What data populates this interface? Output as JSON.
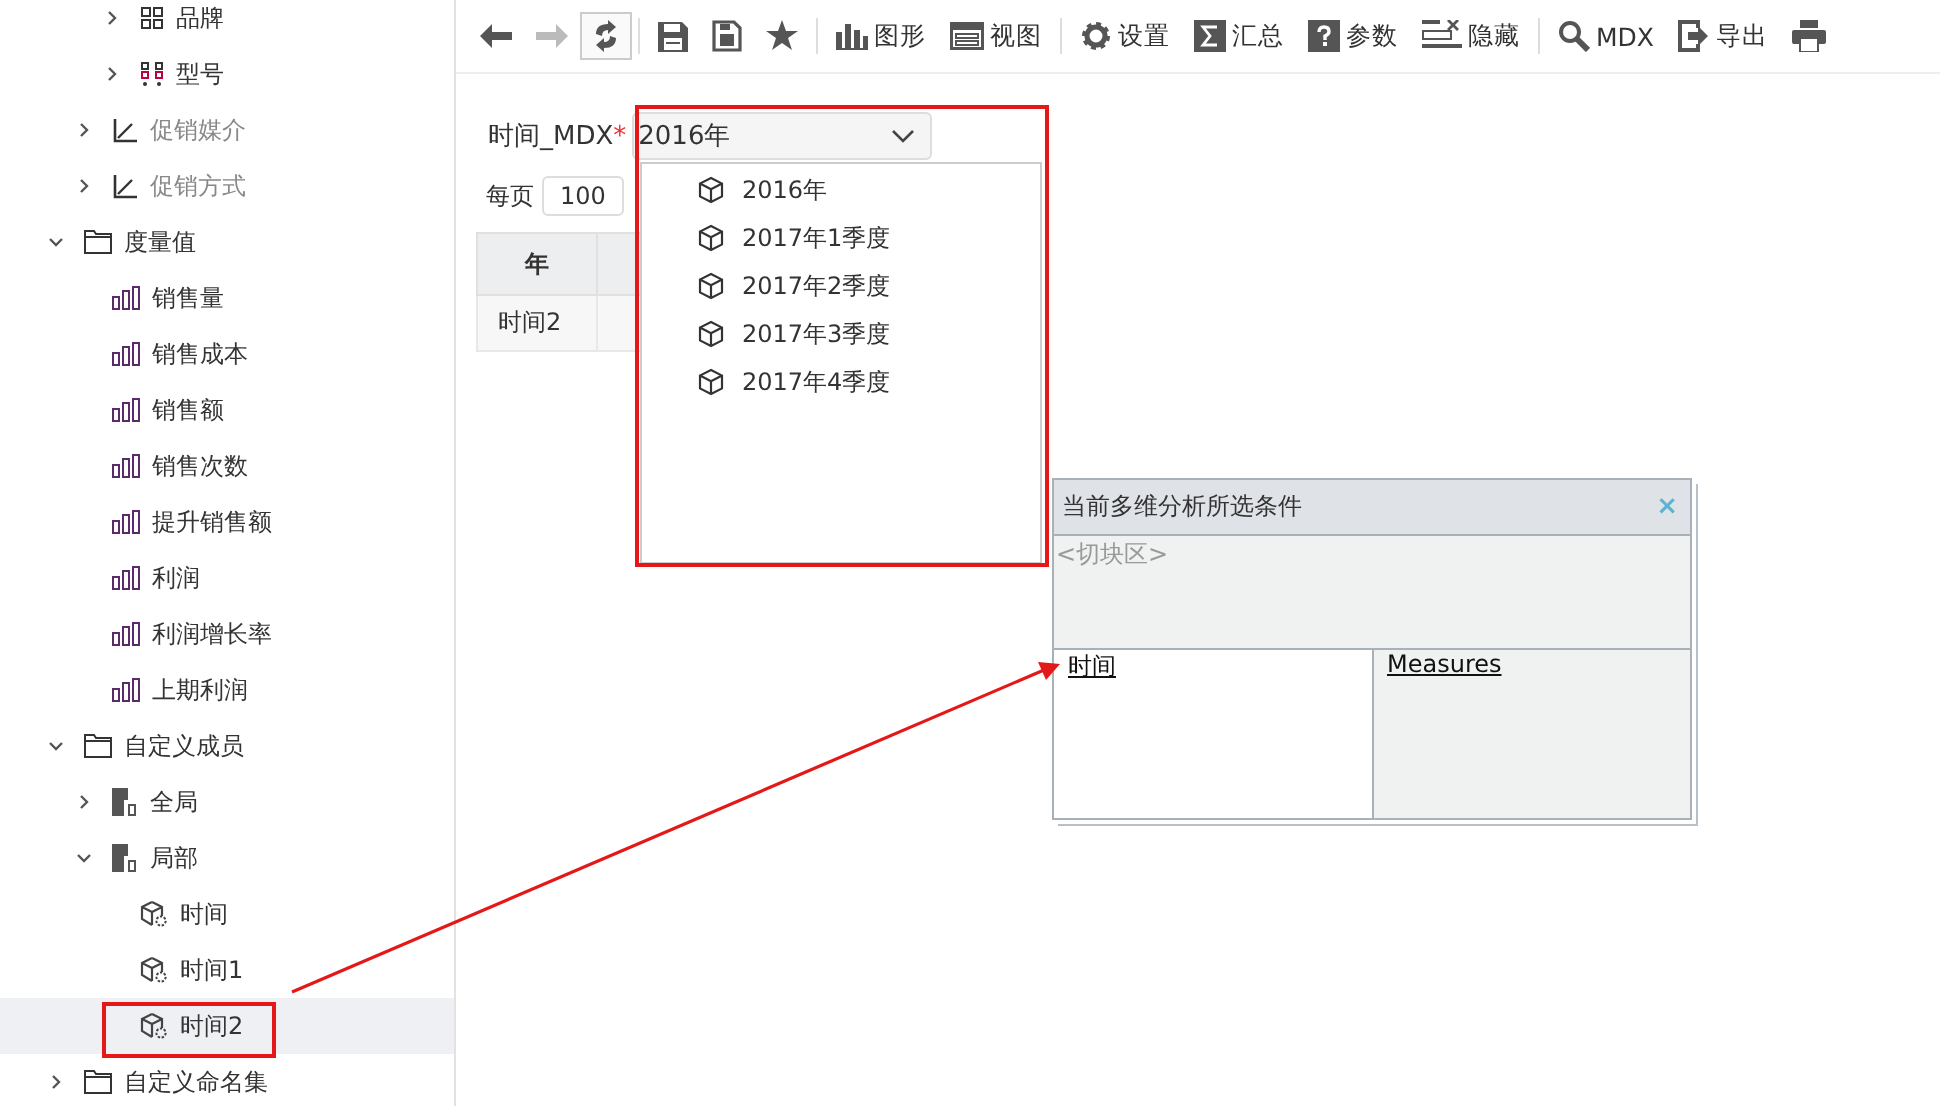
{
  "tree": [
    {
      "children": [
        {
          "children": [
            {
              "label": "品牌",
              "kind": "grid",
              "expanded": false,
              "disabled": false,
              "selected": false
            },
            {
              "label": "型号",
              "kind": "dots",
              "expanded": false,
              "disabled": false,
              "selected": false
            }
          ]
        },
        {
          "label": "促销媒介",
          "kind": "axis",
          "expanded": false,
          "disabled": true,
          "selected": false
        },
        {
          "label": "促销方式",
          "kind": "axis",
          "expanded": false,
          "disabled": true,
          "selected": false
        }
      ]
    },
    {
      "label": "度量值",
      "kind": "folder",
      "expanded": true,
      "disabled": false,
      "selected": false,
      "children": [
        {
          "label": "销售量",
          "kind": "measure",
          "disabled": false,
          "selected": false
        },
        {
          "label": "销售成本",
          "kind": "measure",
          "disabled": false,
          "selected": false
        },
        {
          "label": "销售额",
          "kind": "measure",
          "disabled": false,
          "selected": false
        },
        {
          "label": "销售次数",
          "kind": "measure",
          "disabled": false,
          "selected": false
        },
        {
          "label": "提升销售额",
          "kind": "measure",
          "disabled": false,
          "selected": false
        },
        {
          "label": "利润",
          "kind": "measure",
          "disabled": false,
          "selected": false
        },
        {
          "label": "利润增长率",
          "kind": "measure",
          "disabled": false,
          "selected": false
        },
        {
          "label": "上期利润",
          "kind": "measure",
          "disabled": false,
          "selected": false
        }
      ]
    },
    {
      "label": "自定义成员",
      "kind": "folder",
      "expanded": true,
      "disabled": false,
      "selected": false,
      "children": [
        {
          "label": "全局",
          "kind": "block",
          "expanded": false,
          "disabled": false,
          "selected": false
        },
        {
          "label": "局部",
          "kind": "block",
          "expanded": true,
          "disabled": false,
          "selected": false,
          "children": [
            {
              "label": "时间",
              "kind": "member",
              "disabled": false,
              "selected": false
            },
            {
              "label": "时间1",
              "kind": "member",
              "disabled": false,
              "selected": false
            },
            {
              "label": "时间2",
              "kind": "member",
              "disabled": false,
              "selected": true
            }
          ]
        }
      ]
    },
    {
      "label": "自定义命名集",
      "kind": "folder",
      "expanded": false,
      "disabled": false,
      "selected": false
    }
  ],
  "toolbar": [
    {
      "kind": "back",
      "disabled": false,
      "active": false
    },
    {
      "kind": "forward",
      "disabled": true,
      "active": false
    },
    {
      "kind": "refresh",
      "disabled": false,
      "active": true
    },
    {
      "kind": "separator"
    },
    {
      "kind": "save",
      "disabled": false,
      "active": false
    },
    {
      "kind": "saveas",
      "disabled": false,
      "active": false
    },
    {
      "kind": "star",
      "disabled": false,
      "active": false
    },
    {
      "kind": "separator"
    },
    {
      "kind": "chart",
      "label": "图形",
      "disabled": false,
      "active": false
    },
    {
      "kind": "view",
      "label": "视图",
      "disabled": false,
      "active": false
    },
    {
      "kind": "separator"
    },
    {
      "kind": "gear",
      "label": "设置",
      "disabled": false,
      "active": false
    },
    {
      "kind": "sigma",
      "label": "汇总",
      "disabled": false,
      "active": false
    },
    {
      "kind": "help",
      "label": "参数",
      "disabled": false,
      "active": false
    },
    {
      "kind": "hide",
      "label": "隐藏",
      "disabled": false,
      "active": false
    },
    {
      "kind": "separator"
    },
    {
      "kind": "search",
      "label": "MDX",
      "disabled": false,
      "active": false
    },
    {
      "kind": "export",
      "label": "导出",
      "disabled": false,
      "active": false
    },
    {
      "kind": "print",
      "disabled": false,
      "active": false
    }
  ],
  "param": {
    "label": "时间_MDX",
    "required_mark": "*",
    "value": "2016年",
    "options": [
      "2016年",
      "2017年1季度",
      "2017年2季度",
      "2017年3季度",
      "2017年4季度"
    ]
  },
  "paging": {
    "label": "每页",
    "value": "100"
  },
  "table": {
    "columns": [
      "年"
    ],
    "rows": [
      [
        "时间2"
      ]
    ]
  },
  "panel": {
    "title": "当前多维分析所选条件",
    "close": "×",
    "slicer": "<切块区>",
    "axes": [
      "时间",
      "Measures"
    ]
  }
}
